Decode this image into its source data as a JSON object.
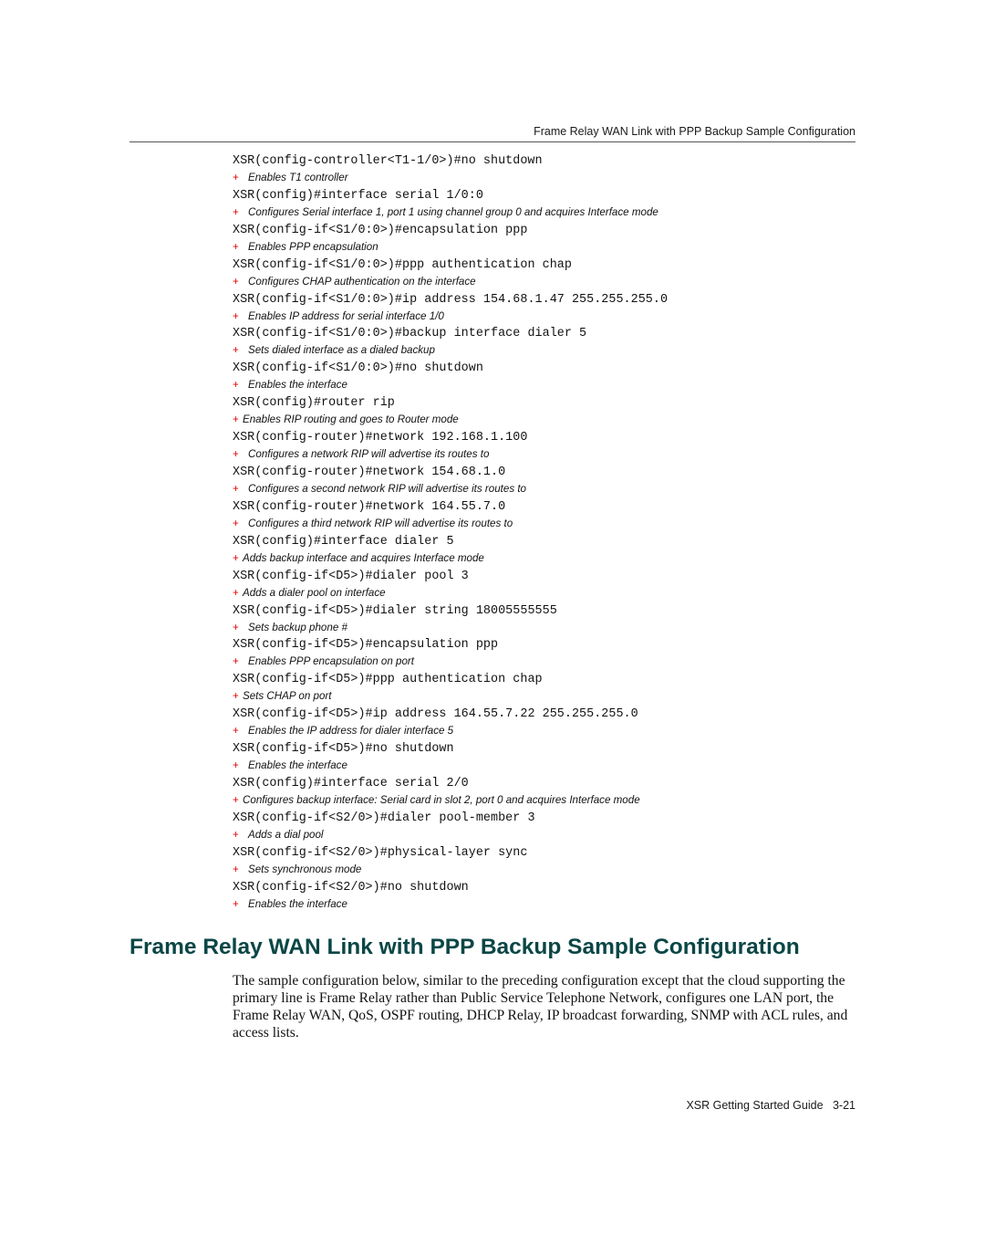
{
  "header": {
    "running_title": "Frame Relay WAN Link with PPP Backup Sample Configuration"
  },
  "config": {
    "bullet_icon": "+",
    "entries": [
      {
        "prompt": "XSR(config-controller<T1-1/0>)#",
        "command": "no shutdown",
        "note": "Enables T1 controller",
        "tight": false
      },
      {
        "prompt": "XSR(config)#",
        "command": "interface serial 1/0:0",
        "note": "Configures Serial interface 1, port 1 using channel group 0 and acquires Interface mode",
        "tight": false
      },
      {
        "prompt": "XSR(config-if<S1/0:0>)#",
        "command": "encapsulation ppp",
        "note": "Enables PPP encapsulation",
        "tight": false
      },
      {
        "prompt": "XSR(config-if<S1/0:0>)#",
        "command": "ppp authentication chap",
        "note": "Configures CHAP authentication on the interface",
        "tight": false
      },
      {
        "prompt": "XSR(config-if<S1/0:0>)#",
        "command": "ip address 154.68.1.47 255.255.255.0",
        "note": "Enables IP address for serial interface 1/0",
        "tight": false
      },
      {
        "prompt": "XSR(config-if<S1/0:0>)#",
        "command": "backup interface dialer 5",
        "note": "Sets dialed interface as a dialed backup",
        "tight": false
      },
      {
        "prompt": "XSR(config-if<S1/0:0>)#",
        "command": "no shutdown",
        "note": "Enables the interface",
        "tight": false
      },
      {
        "prompt": "XSR(config)#",
        "command": "router rip",
        "note": "Enables RIP routing and goes to Router mode",
        "tight": true
      },
      {
        "prompt": "XSR(config-router)#",
        "command": "network 192.168.1.100",
        "note": "Configures a network RIP will advertise its routes to",
        "tight": false
      },
      {
        "prompt": "XSR(config-router)#",
        "command": "network 154.68.1.0",
        "note": "Configures a second network RIP will advertise its routes to",
        "tight": false
      },
      {
        "prompt": "XSR(config-router)#",
        "command": "network 164.55.7.0",
        "note": "Configures a third network RIP will advertise its routes to",
        "tight": false
      },
      {
        "prompt": "XSR(config)#",
        "command": "interface dialer 5",
        "note": "Adds backup interface and acquires Interface mode",
        "tight": true
      },
      {
        "prompt": "XSR(config-if<D5>)#",
        "command": "dialer pool 3",
        "note": "Adds a dialer pool on interface",
        "tight": true
      },
      {
        "prompt": "XSR(config-if<D5>)#",
        "command": "dialer string 18005555555",
        "note": "Sets backup phone #",
        "tight": false
      },
      {
        "prompt": "XSR(config-if<D5>)#",
        "command": "encapsulation ppp",
        "note": "Enables PPP encapsulation on port",
        "tight": false
      },
      {
        "prompt": "XSR(config-if<D5>)#",
        "command": "ppp authentication chap",
        "note": "Sets CHAP on port",
        "tight": true
      },
      {
        "prompt": "XSR(config-if<D5>)#",
        "command": "ip address 164.55.7.22 255.255.255.0",
        "note": "Enables the IP address for dialer interface 5",
        "tight": false
      },
      {
        "prompt": "XSR(config-if<D5>)#",
        "command": "no shutdown",
        "note": "Enables the interface",
        "tight": false
      },
      {
        "prompt": "XSR(config)#",
        "command": "interface serial 2/0",
        "note": "Configures backup interface: Serial card in slot 2, port 0 and acquires Interface mode",
        "tight": true
      },
      {
        "prompt": "XSR(config-if<S2/0>)#",
        "command": "dialer pool-member 3",
        "note": "Adds a dial pool",
        "tight": false
      },
      {
        "prompt": "XSR(config-if<S2/0>)#",
        "command": "physical-layer sync",
        "note": "Sets synchronous mode",
        "tight": false
      },
      {
        "prompt": "XSR(config-if<S2/0>)#",
        "command": "no shutdown",
        "note": "Enables the interface",
        "tight": false
      }
    ]
  },
  "section": {
    "title": "Frame Relay WAN Link with PPP Backup Sample Configuration",
    "body": "The sample configuration below, similar to the preceding configuration except that the cloud supporting the primary line is Frame Relay rather than Public Service Telephone Network, configures one LAN port, the Frame Relay WAN, QoS, OSPF routing, DHCP Relay, IP broadcast forwarding, SNMP with ACL rules, and access lists."
  },
  "footer": {
    "guide_title": "XSR Getting Started Guide",
    "page_number": "3-21"
  },
  "colors": {
    "heading": "#0b4646",
    "bullet": "#e00000",
    "text": "#111111"
  }
}
